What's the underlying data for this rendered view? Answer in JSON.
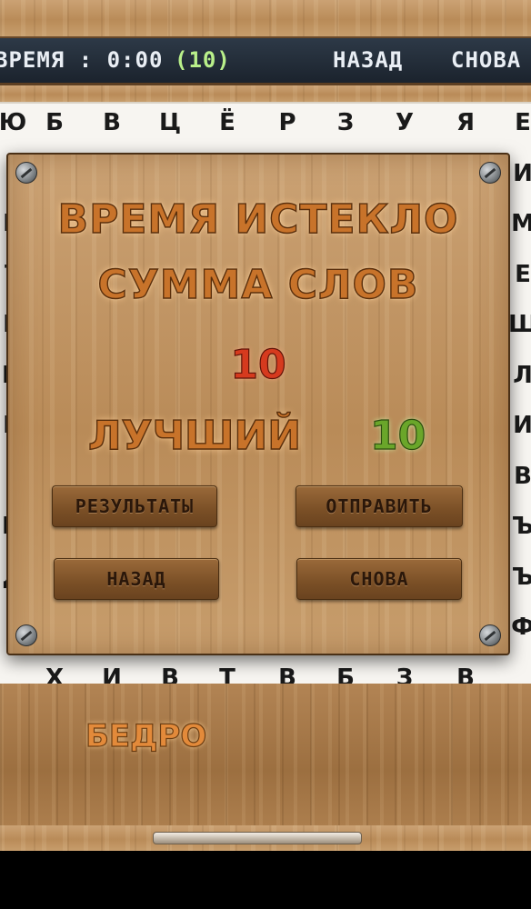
{
  "topbar": {
    "timer_label": "ВРЕМЯ : 0:00",
    "score_count": "(10)",
    "back_link": "НАЗАД",
    "again_link": "СНОВА"
  },
  "grid": {
    "rows": [
      [
        "Ю",
        "Б",
        "В",
        "Ц",
        "Ё",
        "Р",
        "З",
        "У",
        "Я",
        "Е"
      ],
      [
        "",
        "",
        "",
        "",
        "",
        "",
        "",
        "",
        "",
        "И"
      ],
      [
        "И",
        "",
        "",
        "",
        "",
        "",
        "",
        "",
        "",
        "М"
      ],
      [
        "Т",
        "",
        "",
        "",
        "",
        "",
        "",
        "",
        "",
        "Е"
      ],
      [
        "И",
        "",
        "",
        "",
        "",
        "",
        "",
        "",
        "",
        "Ш"
      ],
      [
        "Ц",
        "",
        "",
        "",
        "",
        "",
        "",
        "",
        "",
        "Л"
      ],
      [
        "И",
        "",
        "",
        "",
        "",
        "",
        "",
        "",
        "",
        "И"
      ],
      [
        "Е",
        "",
        "",
        "",
        "",
        "",
        "",
        "",
        "",
        "В"
      ],
      [
        "Ц",
        "",
        "",
        "",
        "",
        "",
        "",
        "",
        "",
        "Ъ"
      ],
      [
        "Д",
        "",
        "",
        "",
        "",
        "",
        "",
        "",
        "",
        "Ъ"
      ],
      [
        "Е",
        "",
        "",
        "",
        "",
        "",
        "",
        "",
        "",
        "Ф"
      ],
      [
        "",
        "Х",
        "И",
        "В",
        "Т",
        "В",
        "Б",
        "З",
        "В",
        ""
      ]
    ]
  },
  "modal": {
    "title_timeout": "ВРЕМЯ ИСТЕКЛО",
    "title_sum": "СУММА СЛОВ",
    "score_value": "10",
    "best_label": "ЛУЧШИЙ",
    "best_value": "10",
    "buttons": {
      "results": "РЕЗУЛЬТАТЫ",
      "send": "ОТПРАВИТЬ",
      "back": "НАЗАД",
      "again": "СНОВА"
    }
  },
  "current_word": "БЕДРО",
  "colors": {
    "title_orange": "#c8732a",
    "score_red": "#d63a1e",
    "best_green": "#6aa62a",
    "bar_dark": "#1f2833"
  }
}
